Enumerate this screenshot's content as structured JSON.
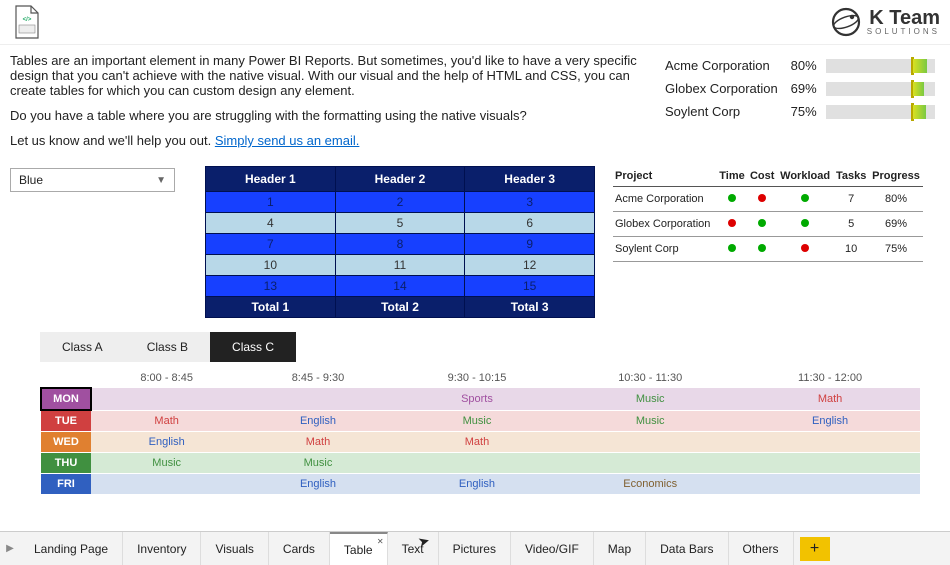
{
  "brand": {
    "name": "K Team",
    "sub": "SOLUTIONS"
  },
  "intro": {
    "p1": "Tables are an important element in many Power BI Reports. But sometimes, you'd like to have a very specific design that you can't achieve with the native visual. With our visual and the help of HTML and CSS, you can create tables for which you can custom design any element.",
    "p2": "Do you have a table where you are struggling with the formatting using the native visuals?",
    "p3_prefix": "Let us know and we'll help you out. ",
    "link": "Simply send us an email."
  },
  "progress": [
    {
      "name": "Acme Corporation",
      "pct": "80%",
      "marker": 78,
      "fill_start": 80,
      "fill_width": 13
    },
    {
      "name": "Globex Corporation",
      "pct": "69%",
      "marker": 78,
      "fill_start": 80,
      "fill_width": 10
    },
    {
      "name": "Soylent Corp",
      "pct": "75%",
      "marker": 78,
      "fill_start": 80,
      "fill_width": 12
    }
  ],
  "dropdown": {
    "value": "Blue"
  },
  "color_table": {
    "headers": [
      "Header 1",
      "Header 2",
      "Header 3"
    ],
    "rows": [
      [
        "1",
        "2",
        "3"
      ],
      [
        "4",
        "5",
        "6"
      ],
      [
        "7",
        "8",
        "9"
      ],
      [
        "10",
        "11",
        "12"
      ],
      [
        "13",
        "14",
        "15"
      ]
    ],
    "totals": [
      "Total 1",
      "Total 2",
      "Total 3"
    ]
  },
  "projects": {
    "headers": [
      "Project",
      "Time",
      "Cost",
      "Workload",
      "Tasks",
      "Progress"
    ],
    "rows": [
      {
        "name": "Acme Corporation",
        "time": "green",
        "cost": "red",
        "workload": "green",
        "tasks": "7",
        "progress": "80%"
      },
      {
        "name": "Globex Corporation",
        "time": "red",
        "cost": "green",
        "workload": "green",
        "tasks": "5",
        "progress": "69%"
      },
      {
        "name": "Soylent Corp",
        "time": "green",
        "cost": "green",
        "workload": "red",
        "tasks": "10",
        "progress": "75%"
      }
    ]
  },
  "class_tabs": [
    "Class A",
    "Class B",
    "Class C"
  ],
  "active_class": 2,
  "schedule": {
    "times": [
      "8:00 - 8:45",
      "8:45 - 9:30",
      "9:30 - 10:15",
      "10:30 - 11:30",
      "11:30 - 12:00"
    ],
    "days": [
      {
        "code": "MON",
        "cls": "mon",
        "cells": [
          "",
          "",
          "Sports",
          "Music",
          "Math"
        ]
      },
      {
        "code": "TUE",
        "cls": "tue",
        "cells": [
          "Math",
          "English",
          "Music",
          "Music",
          "English"
        ]
      },
      {
        "code": "WED",
        "cls": "wed",
        "cells": [
          "English",
          "Math",
          "Math",
          "",
          ""
        ]
      },
      {
        "code": "THU",
        "cls": "thu",
        "cells": [
          "Music",
          "Music",
          "",
          "",
          ""
        ]
      },
      {
        "code": "FRI",
        "cls": "fri",
        "cells": [
          "",
          "English",
          "English",
          "Economics",
          ""
        ]
      }
    ]
  },
  "subject_class": {
    "Math": "sub-math",
    "English": "sub-english",
    "Music": "sub-music",
    "Sports": "sub-sports",
    "Economics": "sub-economics"
  },
  "page_tabs": [
    "Landing Page",
    "Inventory",
    "Visuals",
    "Cards",
    "Table",
    "Text",
    "Pictures",
    "Video/GIF",
    "Map",
    "Data Bars",
    "Others"
  ],
  "active_page": 4
}
